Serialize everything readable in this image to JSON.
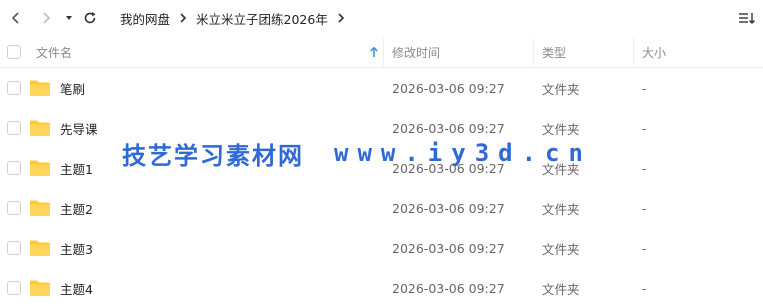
{
  "toolbar": {
    "back_icon": "chevron-left-icon",
    "forward_icon": "chevron-right-icon",
    "history_icon": "caret-down-icon",
    "refresh_icon": "refresh-icon",
    "sort_icon": "sort-list-icon"
  },
  "breadcrumb": [
    "我的网盘",
    "米立米立子团练2026年"
  ],
  "columns": {
    "name": "文件名",
    "mtime": "修改时间",
    "type": "类型",
    "size": "大小"
  },
  "rows": [
    {
      "name": "笔刷",
      "mtime": "2026-03-06 09:27",
      "type": "文件夹",
      "size": "-"
    },
    {
      "name": "先导课",
      "mtime": "2026-03-06 09:27",
      "type": "文件夹",
      "size": "-"
    },
    {
      "name": "主题1",
      "mtime": "2026-03-06 09:27",
      "type": "文件夹",
      "size": "-"
    },
    {
      "name": "主题2",
      "mtime": "2026-03-06 09:27",
      "type": "文件夹",
      "size": "-"
    },
    {
      "name": "主题3",
      "mtime": "2026-03-06 09:27",
      "type": "文件夹",
      "size": "-"
    },
    {
      "name": "主题4",
      "mtime": "2026-03-06 09:27",
      "type": "文件夹",
      "size": "-"
    }
  ],
  "watermark": {
    "text_cn": "技艺学习素材网",
    "text_url": "www.iy3d.cn"
  },
  "colors": {
    "folder": "#ffc83d",
    "accent": "#2f6ad4",
    "sort_arrow": "#4a90e2"
  }
}
